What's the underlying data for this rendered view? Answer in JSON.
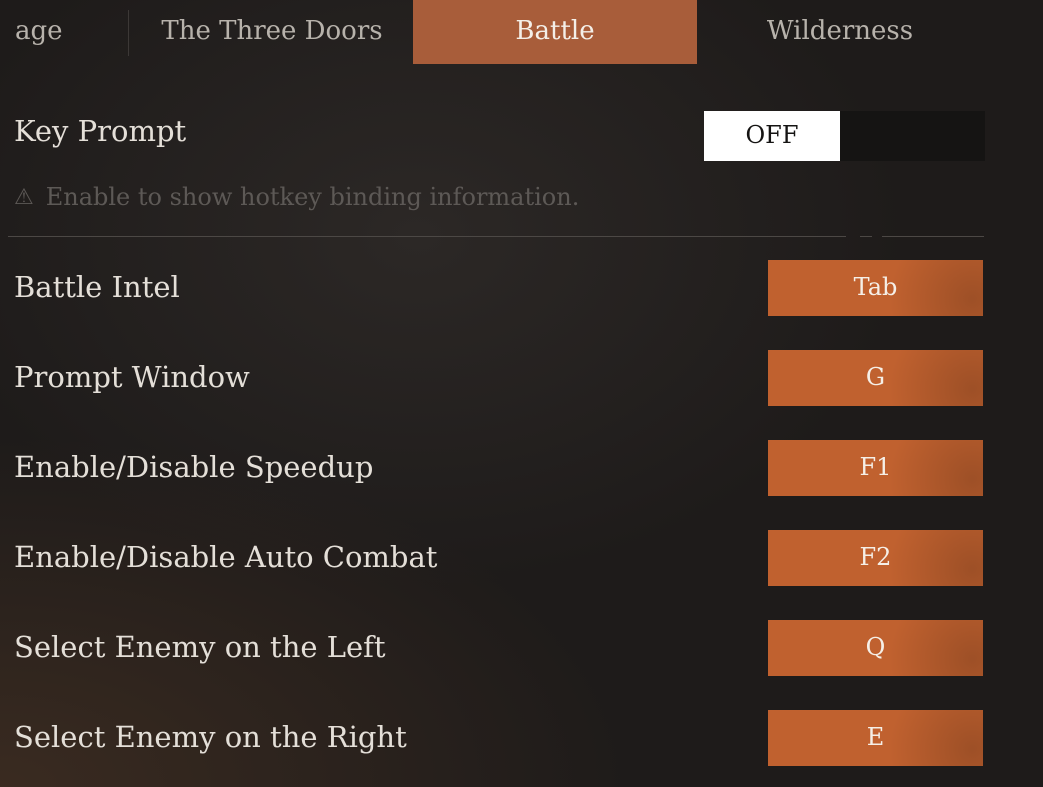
{
  "tabs": [
    {
      "label": "age"
    },
    {
      "label": "The Three Doors"
    },
    {
      "label": "Battle"
    },
    {
      "label": "Wilderness"
    }
  ],
  "active_tab": "Battle",
  "key_prompt": {
    "label": "Key Prompt",
    "toggle_value": "OFF",
    "hint_icon": "warning-triangle-icon",
    "hint": "Enable to show hotkey binding information."
  },
  "bindings": [
    {
      "label": "Battle Intel",
      "key": "Tab"
    },
    {
      "label": "Prompt Window",
      "key": "G"
    },
    {
      "label": "Enable/Disable Speedup",
      "key": "F1"
    },
    {
      "label": "Enable/Disable Auto Combat",
      "key": "F2"
    },
    {
      "label": "Select Enemy on the Left",
      "key": "Q"
    },
    {
      "label": "Select Enemy on the Right",
      "key": "E"
    }
  ],
  "colors": {
    "accent_tab": "#a85d3a",
    "key_button": "#c0612f",
    "background": "#1c1a19"
  }
}
